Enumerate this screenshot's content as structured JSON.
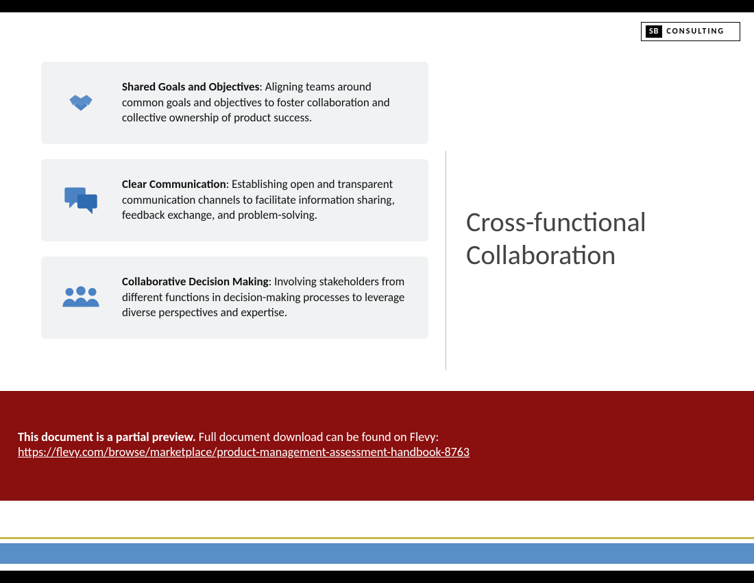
{
  "logo": {
    "badge": "SB",
    "text": "CONSULTING"
  },
  "cards": [
    {
      "icon": "handshake-icon",
      "title": "Shared Goals and Objectives",
      "body": ": Aligning teams around common goals and objectives to foster collaboration and collective ownership of product success."
    },
    {
      "icon": "chat-icon",
      "title": "Clear Communication",
      "body": ": Establishing open and transparent communication channels to facilitate information sharing, feedback exchange, and problem-solving."
    },
    {
      "icon": "group-icon",
      "title": "Collaborative Decision Making",
      "body": ": Involving stakeholders from different functions in decision-making processes to leverage diverse perspectives and expertise."
    }
  ],
  "title": "Cross-functional Collaboration",
  "banner": {
    "lead_bold": "This document is a partial preview.",
    "lead_rest": "  Full document download can be found on Flevy:",
    "url": "https://flevy.com/browse/marketplace/product-management-assessment-handbook-8763"
  }
}
